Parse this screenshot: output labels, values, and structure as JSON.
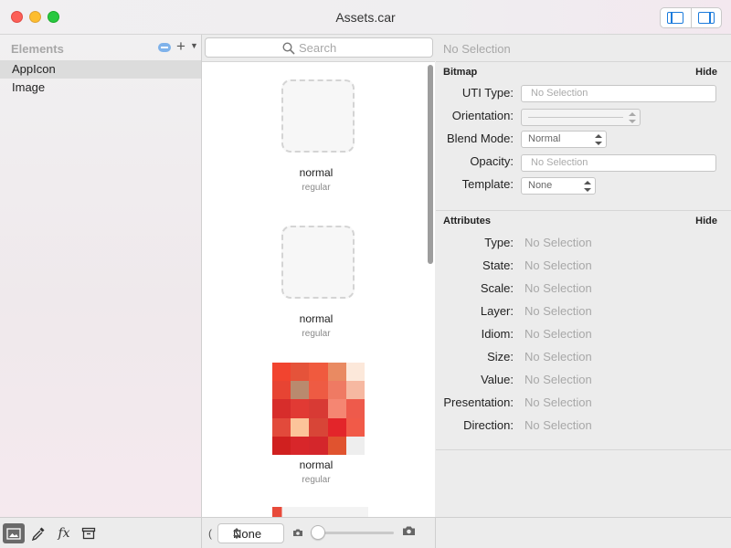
{
  "window": {
    "title": "Assets.car"
  },
  "sidebar": {
    "header": "Elements",
    "items": [
      {
        "label": "AppIcon",
        "selected": true
      },
      {
        "label": "Image",
        "selected": false
      }
    ]
  },
  "search": {
    "placeholder": "Search",
    "value": ""
  },
  "renditions": [
    {
      "name": "normal",
      "subtitle": "regular",
      "kind": "empty"
    },
    {
      "name": "normal",
      "subtitle": "regular",
      "kind": "empty"
    },
    {
      "name": "normal",
      "subtitle": "regular",
      "kind": "pixelated-image"
    }
  ],
  "mosaic_colors": [
    "#f1442f",
    "#e5533a",
    "#f05a3e",
    "#e98a62",
    "#fce8da",
    "#e74433",
    "#b98a6e",
    "#ee5b43",
    "#ef7a63",
    "#f6b8a1",
    "#d72d2b",
    "#e13a34",
    "#d83a34",
    "#f58672",
    "#ee5a4b",
    "#e24a3b",
    "#fcc49a",
    "#d84537",
    "#e3252a",
    "#f15a48",
    "#d0201f",
    "#d8262a",
    "#d4262b",
    "#e0532f",
    "#eeeeee"
  ],
  "inspector": {
    "title": "No Selection",
    "bitmap": {
      "header": "Bitmap",
      "hide_label": "Hide",
      "uti_label": "UTI Type:",
      "uti_placeholder": "No Selection",
      "orientation_label": "Orientation:",
      "blend_label": "Blend Mode:",
      "blend_value": "Normal",
      "opacity_label": "Opacity:",
      "opacity_placeholder": "No Selection",
      "template_label": "Template:",
      "template_value": "None"
    },
    "attributes": {
      "header": "Attributes",
      "hide_label": "Hide",
      "rows": [
        {
          "label": "Type:",
          "value": "No Selection"
        },
        {
          "label": "State:",
          "value": "No Selection"
        },
        {
          "label": "Scale:",
          "value": "No Selection"
        },
        {
          "label": "Layer:",
          "value": "No Selection"
        },
        {
          "label": "Idiom:",
          "value": "No Selection"
        },
        {
          "label": "Size:",
          "value": "No Selection"
        },
        {
          "label": "Value:",
          "value": "No Selection"
        },
        {
          "label": "Presentation:",
          "value": "No Selection"
        },
        {
          "label": "Direction:",
          "value": "No Selection"
        }
      ]
    }
  },
  "bottombar": {
    "tools": [
      "image-icon",
      "eyedropper-icon",
      "fx-icon",
      "archive-icon"
    ],
    "paren": "(",
    "background_value": "None",
    "zoom_fraction": 0.0
  }
}
